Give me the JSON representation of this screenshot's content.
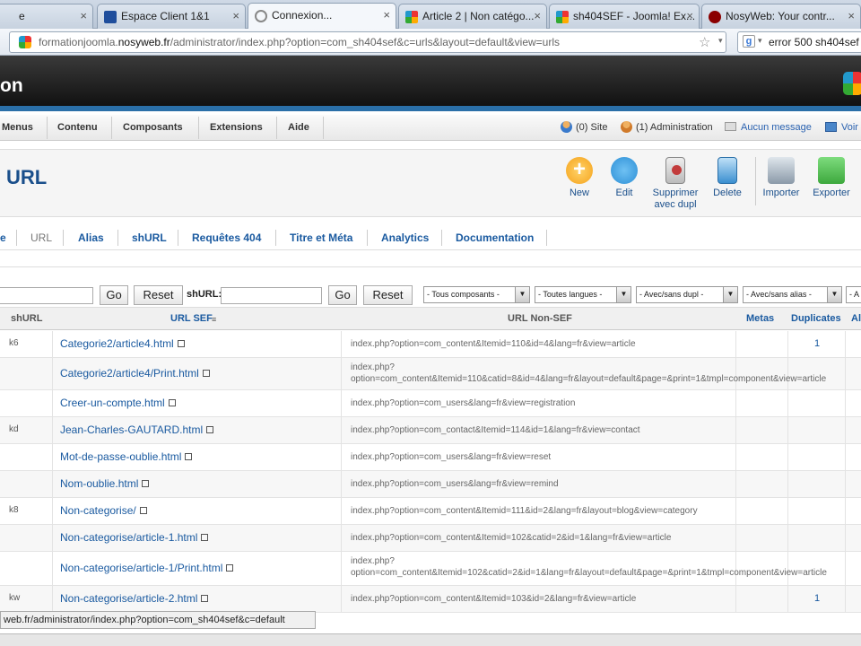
{
  "browser": {
    "tabs": [
      {
        "label": "e",
        "icon": "page-icon"
      },
      {
        "label": "Espace Client 1&1",
        "icon": "oneandone-icon"
      },
      {
        "label": "Connexion...",
        "icon": "loading-icon"
      },
      {
        "label": "Article 2 | Non catégo...",
        "icon": "joomla-icon"
      },
      {
        "label": "sh404SEF - Joomla! Ex...",
        "icon": "joomla-icon"
      },
      {
        "label": "NosyWeb: Your contr...",
        "icon": "nosyweb-icon"
      }
    ],
    "url_prefix": "formationjoomla.",
    "url_domain": "nosyweb.fr",
    "url_rest": "/administrator/index.php?option=com_sh404sef&c=urls&layout=default&view=urls",
    "search_text": "error 500 sh404sef"
  },
  "header": {
    "title": "on"
  },
  "menu": {
    "items": [
      "Menus",
      "Contenu",
      "Composants",
      "Extensions",
      "Aide"
    ],
    "site_status": "(0) Site",
    "admin_status": "(1) Administration",
    "messages": "Aucun message",
    "view": "Voir"
  },
  "toolbar": {
    "title": "URL",
    "buttons": [
      {
        "label": "New",
        "icon": "new-icon",
        "color": "#f5a21b"
      },
      {
        "label": "Edit",
        "icon": "edit-icon",
        "color": "#2d8fd6"
      },
      {
        "label": "Supprimer avec dupl",
        "icon": "delete-dupl-icon",
        "color": "#c23b3b"
      },
      {
        "label": "Delete",
        "icon": "delete-icon",
        "color": "#3b8fd0"
      },
      {
        "label": "Importer",
        "icon": "import-icon",
        "color": "#8a99a8"
      },
      {
        "label": "Exporter",
        "icon": "export-icon",
        "color": "#3da83d"
      }
    ]
  },
  "subtabs": [
    "e",
    "URL",
    "Alias",
    "shURL",
    "Requêtes 404",
    "Titre et Méta",
    "Analytics",
    "Documentation"
  ],
  "filters": {
    "go1": "Go",
    "reset1": "Reset",
    "shurl_label": "shURL:",
    "go2": "Go",
    "reset2": "Reset",
    "selects": [
      "- Tous composants -",
      "- Toutes langues -",
      "- Avec/sans dupl -",
      "- Avec/sans alias -",
      "- A"
    ]
  },
  "table": {
    "headers": {
      "shurl": "shURL",
      "sef": "URL SEF",
      "nonsef": "URL Non-SEF",
      "metas": "Metas",
      "duplicates": "Duplicates",
      "al": "Al"
    },
    "rows": [
      {
        "sh": "k6",
        "sef": "Categorie2/article4.html",
        "non": "index.php?option=com_content&Itemid=110&id=4&lang=fr&view=article",
        "dup": "1"
      },
      {
        "sh": "",
        "sef": "Categorie2/article4/Print.html",
        "non": "index.php?option=com_content&Itemid=110&catid=8&id=4&lang=fr&layout=default&page=&print=1&tmpl=component&view=article",
        "dup": ""
      },
      {
        "sh": "",
        "sef": "Creer-un-compte.html",
        "non": "index.php?option=com_users&lang=fr&view=registration",
        "dup": ""
      },
      {
        "sh": "kd",
        "sef": "Jean-Charles-GAUTARD.html",
        "non": "index.php?option=com_contact&Itemid=114&id=1&lang=fr&view=contact",
        "dup": ""
      },
      {
        "sh": "",
        "sef": "Mot-de-passe-oublie.html",
        "non": "index.php?option=com_users&lang=fr&view=reset",
        "dup": ""
      },
      {
        "sh": "",
        "sef": "Nom-oublie.html",
        "non": "index.php?option=com_users&lang=fr&view=remind",
        "dup": ""
      },
      {
        "sh": "k8",
        "sef": "Non-categorise/",
        "non": "index.php?option=com_content&Itemid=111&id=2&lang=fr&layout=blog&view=category",
        "dup": ""
      },
      {
        "sh": "",
        "sef": "Non-categorise/article-1.html",
        "non": "index.php?option=com_content&Itemid=102&catid=2&id=1&lang=fr&view=article",
        "dup": ""
      },
      {
        "sh": "",
        "sef": "Non-categorise/article-1/Print.html",
        "non": "index.php?option=com_content&Itemid=102&catid=2&id=1&lang=fr&layout=default&page=&print=1&tmpl=component&view=article",
        "dup": ""
      },
      {
        "sh": "kw",
        "sef": "Non-categorise/article-2.html",
        "non": "index.php?option=com_content&Itemid=103&id=2&lang=fr&view=article",
        "dup": "1"
      }
    ]
  },
  "status_url": "web.fr/administrator/index.php?option=com_sh404sef&c=default"
}
